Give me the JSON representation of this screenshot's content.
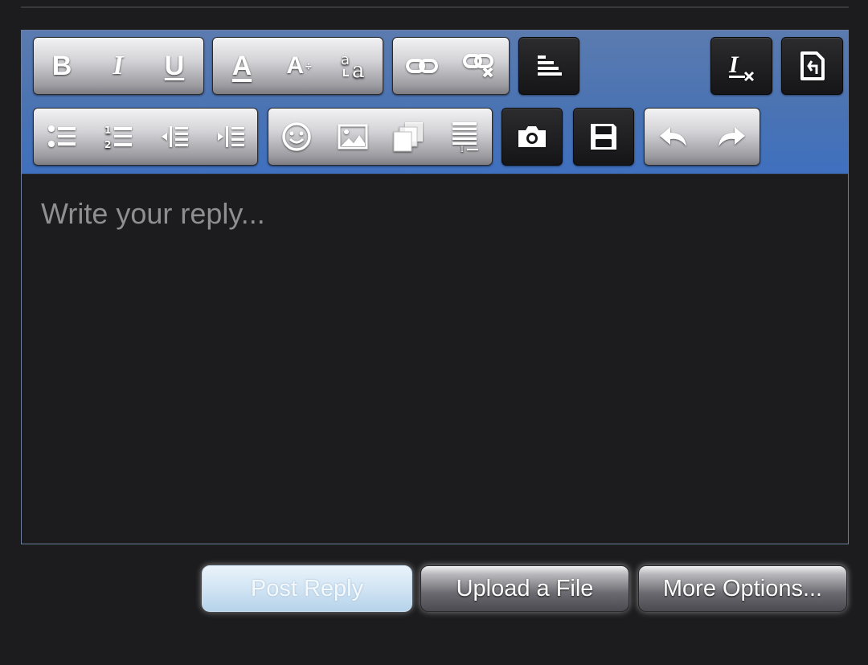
{
  "editor": {
    "placeholder": "Write your reply..."
  },
  "toolbar": {
    "row1": [
      {
        "name": "bold",
        "glyph": "B"
      },
      {
        "name": "italic",
        "glyph": "I"
      },
      {
        "name": "underline",
        "glyph": "U"
      },
      {
        "name": "font-color",
        "glyph": "A"
      },
      {
        "name": "font-size",
        "glyph": "A"
      },
      {
        "name": "font-family",
        "glyph": "a"
      },
      {
        "name": "insert-link",
        "glyph": ""
      },
      {
        "name": "remove-link",
        "glyph": ""
      },
      {
        "name": "align",
        "glyph": ""
      },
      {
        "name": "remove-format",
        "glyph": "I"
      },
      {
        "name": "source",
        "glyph": ""
      }
    ],
    "row2": [
      {
        "name": "bulleted-list"
      },
      {
        "name": "numbered-list"
      },
      {
        "name": "outdent"
      },
      {
        "name": "indent"
      },
      {
        "name": "smiley"
      },
      {
        "name": "image"
      },
      {
        "name": "gallery"
      },
      {
        "name": "quote"
      },
      {
        "name": "camera"
      },
      {
        "name": "save-draft"
      },
      {
        "name": "undo"
      },
      {
        "name": "redo"
      }
    ]
  },
  "actions": {
    "post_reply": "Post Reply",
    "upload_file": "Upload a File",
    "more_options": "More Options..."
  },
  "colors": {
    "background": "#1c1c1e",
    "toolbar": "#4a73b3",
    "placeholder": "#8f8f93"
  }
}
